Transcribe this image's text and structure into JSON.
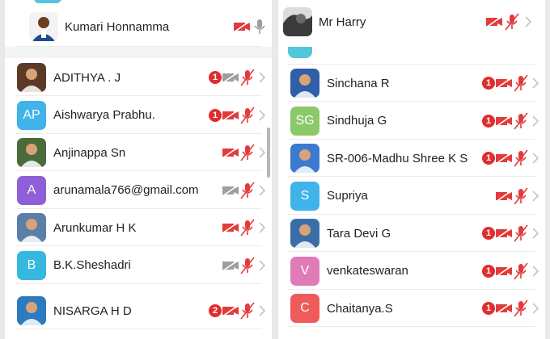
{
  "left": {
    "top_item": {
      "name": "Kumari Honnamma",
      "avatar_color": "#2f6fb3"
    },
    "members": [
      {
        "name": "ADITHYA . J",
        "avatar_type": "photo",
        "avatar_color": "#5c3a28",
        "badge": "1",
        "cam": "gray",
        "mic": "red"
      },
      {
        "name": "Aishwarya Prabhu.",
        "avatar_type": "initials",
        "initials": "AP",
        "avatar_color": "#3fb3ea",
        "badge": "1",
        "cam": "red",
        "mic": "red"
      },
      {
        "name": "Anjinappa Sn",
        "avatar_type": "photo",
        "avatar_color": "#4a6b3a",
        "badge": "",
        "cam": "red",
        "mic": "red"
      },
      {
        "name": "arunamala766@gmail.com",
        "avatar_type": "initials",
        "initials": "A",
        "avatar_color": "#8e5fd6",
        "badge": "",
        "cam": "gray",
        "mic": "red"
      },
      {
        "name": "Arunkumar H K",
        "avatar_type": "photo",
        "avatar_color": "#5b7fa8",
        "badge": "",
        "cam": "red",
        "mic": "red"
      },
      {
        "name": "B.K.Sheshadri",
        "avatar_type": "initials",
        "initials": "B",
        "avatar_color": "#35b8e0",
        "badge": "",
        "cam": "gray",
        "mic": "red"
      },
      {
        "name": "NISARGA H D",
        "avatar_type": "photo",
        "avatar_color": "#2c7bbf",
        "badge": "2",
        "cam": "red",
        "mic": "red"
      }
    ]
  },
  "right": {
    "top_item": {
      "name": "Mr Harry",
      "avatar_color": "#555555"
    },
    "members": [
      {
        "name": "Sinchana R",
        "avatar_type": "photo",
        "avatar_color": "#2e5fa8",
        "badge": "1",
        "cam": "red",
        "mic": "red"
      },
      {
        "name": "Sindhuja G",
        "avatar_type": "initials",
        "initials": "SG",
        "avatar_color": "#8cc96a",
        "badge": "1",
        "cam": "red",
        "mic": "red"
      },
      {
        "name": "SR-006-Madhu Shree K S",
        "avatar_type": "photo",
        "avatar_color": "#3b7ad0",
        "badge": "1",
        "cam": "red",
        "mic": "red"
      },
      {
        "name": "Supriya",
        "avatar_type": "initials",
        "initials": "S",
        "avatar_color": "#3fb3ea",
        "badge": "",
        "cam": "red",
        "mic": "red"
      },
      {
        "name": "Tara Devi G",
        "avatar_type": "photo",
        "avatar_color": "#3a6ea8",
        "badge": "1",
        "cam": "red",
        "mic": "red"
      },
      {
        "name": "venkateswaran",
        "avatar_type": "initials",
        "initials": "V",
        "avatar_color": "#e07bb8",
        "badge": "1",
        "cam": "red",
        "mic": "red"
      },
      {
        "name": "Chaitanya.S",
        "avatar_type": "initials",
        "initials": "C",
        "avatar_color": "#ef5a5a",
        "badge": "1",
        "cam": "red",
        "mic": "red"
      }
    ]
  },
  "colors": {
    "red": "#e33b3b",
    "gray": "#9e9e9e",
    "chevron": "#c4c4c4"
  }
}
